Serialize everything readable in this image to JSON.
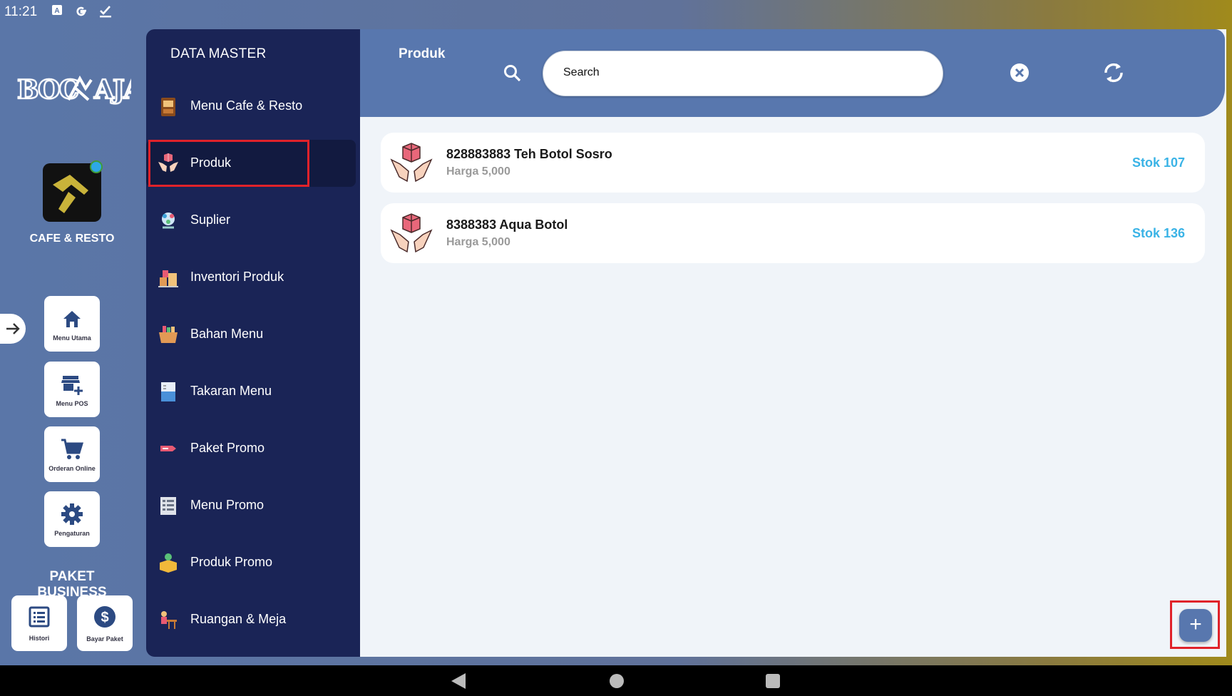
{
  "status_bar": {
    "time": "11:21"
  },
  "brand": {
    "logo_text": "BOC AJA",
    "app_name": "CAFE & RESTO"
  },
  "rail": {
    "buttons": [
      {
        "label": "Menu Utama",
        "icon": "home-icon"
      },
      {
        "label": "Menu POS",
        "icon": "store-add-icon"
      },
      {
        "label": "Orderan Online",
        "icon": "cart-icon"
      },
      {
        "label": "Pengaturan",
        "icon": "gear-icon"
      }
    ],
    "paket_title": "PAKET BUSINESS",
    "paket_buttons": [
      {
        "label": "Histori",
        "icon": "list-icon"
      },
      {
        "label": "Bayar Paket",
        "icon": "dollar-icon"
      }
    ]
  },
  "master": {
    "title": "DATA MASTER",
    "items": [
      {
        "label": "Menu Cafe & Resto",
        "icon": "menu-board-icon"
      },
      {
        "label": "Produk",
        "icon": "product-hands-icon",
        "active": true
      },
      {
        "label": "Suplier",
        "icon": "supplier-icon"
      },
      {
        "label": "Inventori Produk",
        "icon": "inventory-icon"
      },
      {
        "label": "Bahan Menu",
        "icon": "basket-icon"
      },
      {
        "label": "Takaran Menu",
        "icon": "measuring-cup-icon"
      },
      {
        "label": "Paket Promo",
        "icon": "promo-tag-icon"
      },
      {
        "label": "Menu Promo",
        "icon": "promo-menu-icon"
      },
      {
        "label": "Produk Promo",
        "icon": "promo-box-icon"
      },
      {
        "label": "Ruangan & Meja",
        "icon": "room-table-icon"
      }
    ]
  },
  "header": {
    "title": "Produk",
    "search_placeholder": "Search"
  },
  "products": [
    {
      "name": "828883883 Teh Botol Sosro",
      "price": "Harga 5,000",
      "stock": "Stok 107"
    },
    {
      "name": "8388383 Aqua Botol",
      "price": "Harga 5,000",
      "stock": "Stok 136"
    }
  ],
  "fab": {
    "label": "+"
  },
  "colors": {
    "panel": "#1a2456",
    "header": "#5877ae",
    "stock": "#3ab3e6",
    "highlight": "#e0222a"
  }
}
